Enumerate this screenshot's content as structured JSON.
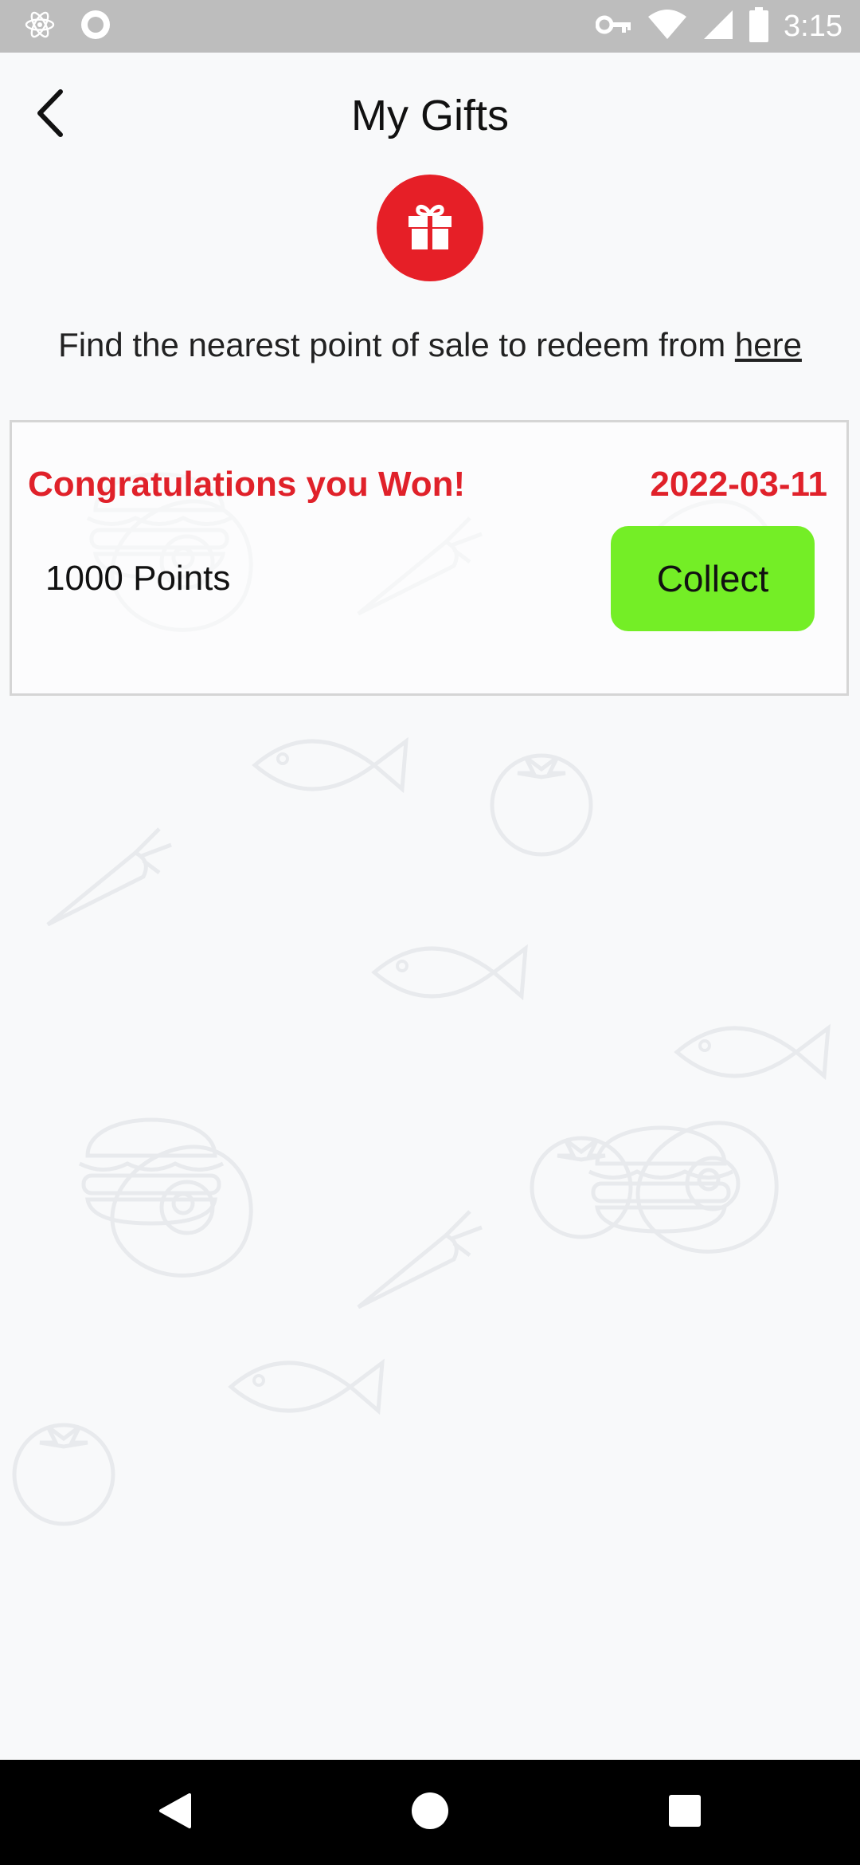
{
  "status_bar": {
    "time": "3:15",
    "left_icons": [
      "react-atom-icon",
      "circle-record-icon"
    ],
    "right_icons": [
      "vpn-key-icon",
      "wifi-icon",
      "signal-icon",
      "battery-icon"
    ]
  },
  "header": {
    "title": "My Gifts",
    "back_icon": "chevron-left-icon"
  },
  "gift_icon": "gift-icon",
  "accent_color": "#e61f27",
  "redeem": {
    "text": "Find the nearest point of sale to redeem from ",
    "link_label": "here"
  },
  "gift_card": {
    "title": "Congratulations you Won!",
    "date": "2022-03-11",
    "reward": "1000 Points",
    "collect_label": "Collect",
    "collect_color": "#74ee26"
  },
  "nav_bar": {
    "items": [
      "back-triangle-icon",
      "home-circle-icon",
      "recents-square-icon"
    ]
  }
}
